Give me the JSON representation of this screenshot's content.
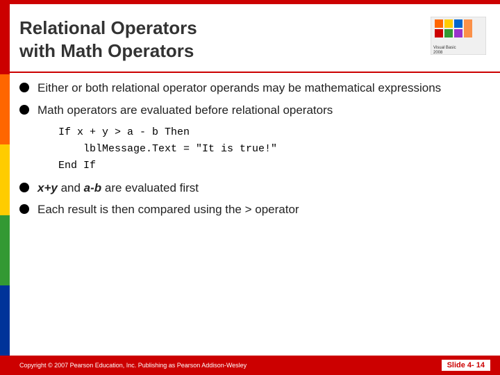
{
  "slide": {
    "top_border_color": "#cc0000",
    "header": {
      "title_line1": "Relational Operators",
      "title_line2": "with Math Operators"
    },
    "bullets": [
      {
        "id": "bullet1",
        "text": "Either or both relational operator operands may be mathematical expressions"
      },
      {
        "id": "bullet2",
        "text": "Math operators are evaluated before relational operators"
      },
      {
        "id": "bullet3",
        "text_before": "",
        "bold_italic": "x+y",
        "text_mid": " and ",
        "bold_italic2": "a-b",
        "text_after": " are evaluated first"
      },
      {
        "id": "bullet4",
        "text": "Each result is then compared using the > operator"
      }
    ],
    "code": {
      "line1": "If x + y > a - b Then",
      "line2": "    lblMessage.Text = \"It is true!\"",
      "line3": "End If"
    },
    "footer": {
      "copyright": "Copyright © 2007 Pearson Education, Inc.  Publishing as Pearson Addison-Wesley",
      "slide_number": "Slide 4- 14"
    }
  }
}
